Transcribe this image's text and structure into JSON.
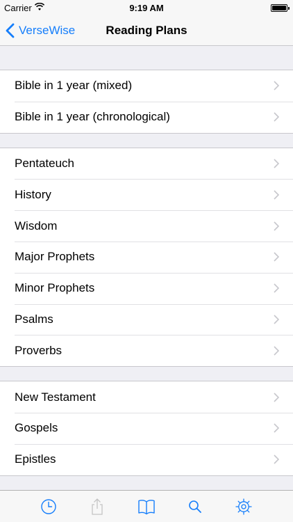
{
  "status_bar": {
    "carrier": "Carrier",
    "time": "9:19 AM"
  },
  "nav": {
    "back_label": "VerseWise",
    "title": "Reading Plans"
  },
  "groups": [
    {
      "items": [
        "Bible in 1 year (mixed)",
        "Bible in 1 year (chronological)"
      ]
    },
    {
      "items": [
        "Pentateuch",
        "History",
        "Wisdom",
        "Major Prophets",
        "Minor Prophets",
        "Psalms",
        "Proverbs"
      ]
    },
    {
      "items": [
        "New Testament",
        "Gospels",
        "Epistles"
      ]
    }
  ],
  "tab_bar": {
    "items": [
      {
        "icon": "clock-icon"
      },
      {
        "icon": "share-icon",
        "disabled": true
      },
      {
        "icon": "book-icon"
      },
      {
        "icon": "search-icon"
      },
      {
        "icon": "gear-icon"
      }
    ]
  },
  "colors": {
    "accent": "#157efb",
    "disabled": "#c4c4c4",
    "chevron": "#c7c7cc"
  }
}
